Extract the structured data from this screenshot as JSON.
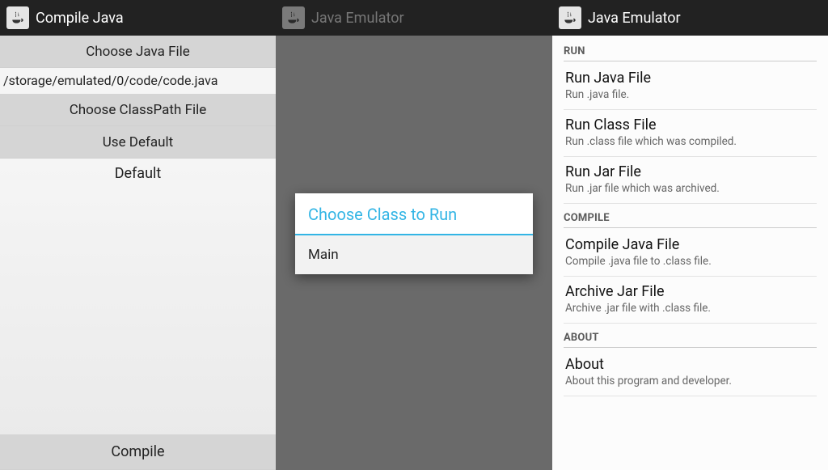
{
  "panel1": {
    "title": "Compile Java",
    "choose_java": "Choose Java File",
    "path": "/storage/emulated/0/code/code.java",
    "choose_classpath": "Choose ClassPath File",
    "use_default": "Use Default",
    "default_label": "Default",
    "compile": "Compile"
  },
  "panel2": {
    "title": "Java Emulator",
    "dialog_title": "Choose Class to Run",
    "options": [
      "Main"
    ]
  },
  "panel3": {
    "title": "Java Emulator",
    "sections": [
      {
        "header": "RUN",
        "items": [
          {
            "title": "Run Java File",
            "sub": "Run .java file."
          },
          {
            "title": "Run Class File",
            "sub": "Run .class file which was compiled."
          },
          {
            "title": "Run Jar File",
            "sub": "Run .jar file which was archived."
          }
        ]
      },
      {
        "header": "COMPILE",
        "items": [
          {
            "title": "Compile Java File",
            "sub": "Compile .java file to .class file."
          },
          {
            "title": "Archive Jar File",
            "sub": "Archive .jar file with .class file."
          }
        ]
      },
      {
        "header": "ABOUT",
        "items": [
          {
            "title": "About",
            "sub": "About this program and developer."
          }
        ]
      }
    ]
  }
}
